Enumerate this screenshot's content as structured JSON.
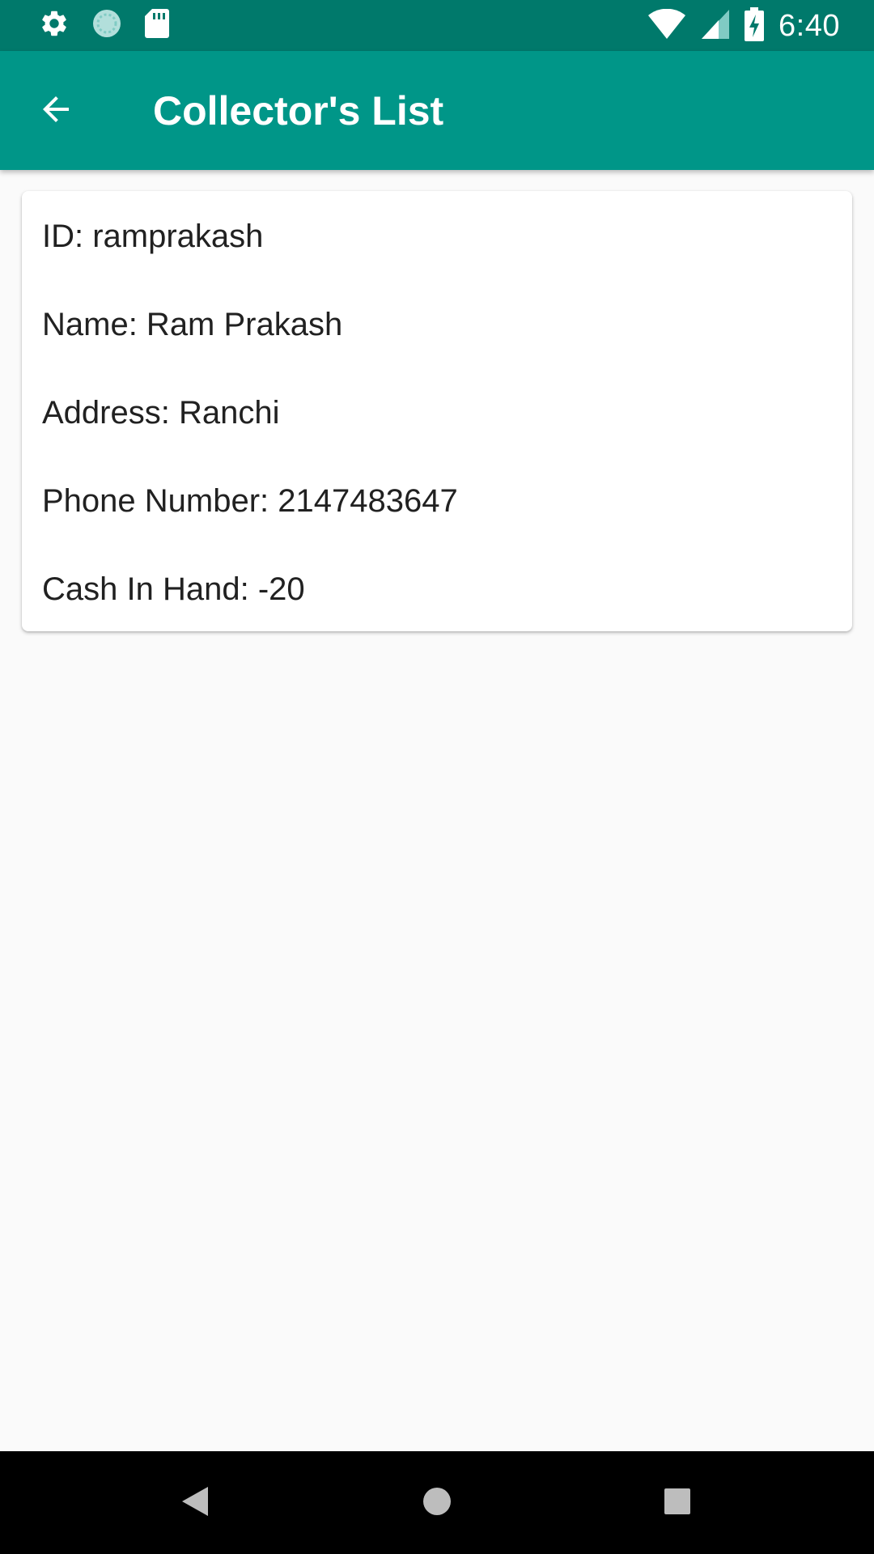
{
  "status_bar": {
    "time": "6:40",
    "left_icons": [
      "gear-icon",
      "sync-icon",
      "sd-card-icon"
    ],
    "right_icons": [
      "wifi-icon",
      "signal-icon",
      "battery-charging-icon"
    ]
  },
  "app_bar": {
    "title": "Collector's List",
    "back_icon": "arrow-back-icon"
  },
  "collectors": [
    {
      "id": "ID: ramprakash",
      "name": "Name: Ram Prakash",
      "address": "Address: Ranchi",
      "phone": "Phone Number: 2147483647",
      "cash": "Cash In Hand: -20"
    }
  ],
  "nav_bar": {
    "icons": [
      "back-triangle-icon",
      "home-circle-icon",
      "recents-square-icon"
    ]
  },
  "colors": {
    "status_bar": "#00796b",
    "app_bar": "#009688",
    "background": "#fafafa",
    "card": "#ffffff",
    "text": "#212121"
  }
}
